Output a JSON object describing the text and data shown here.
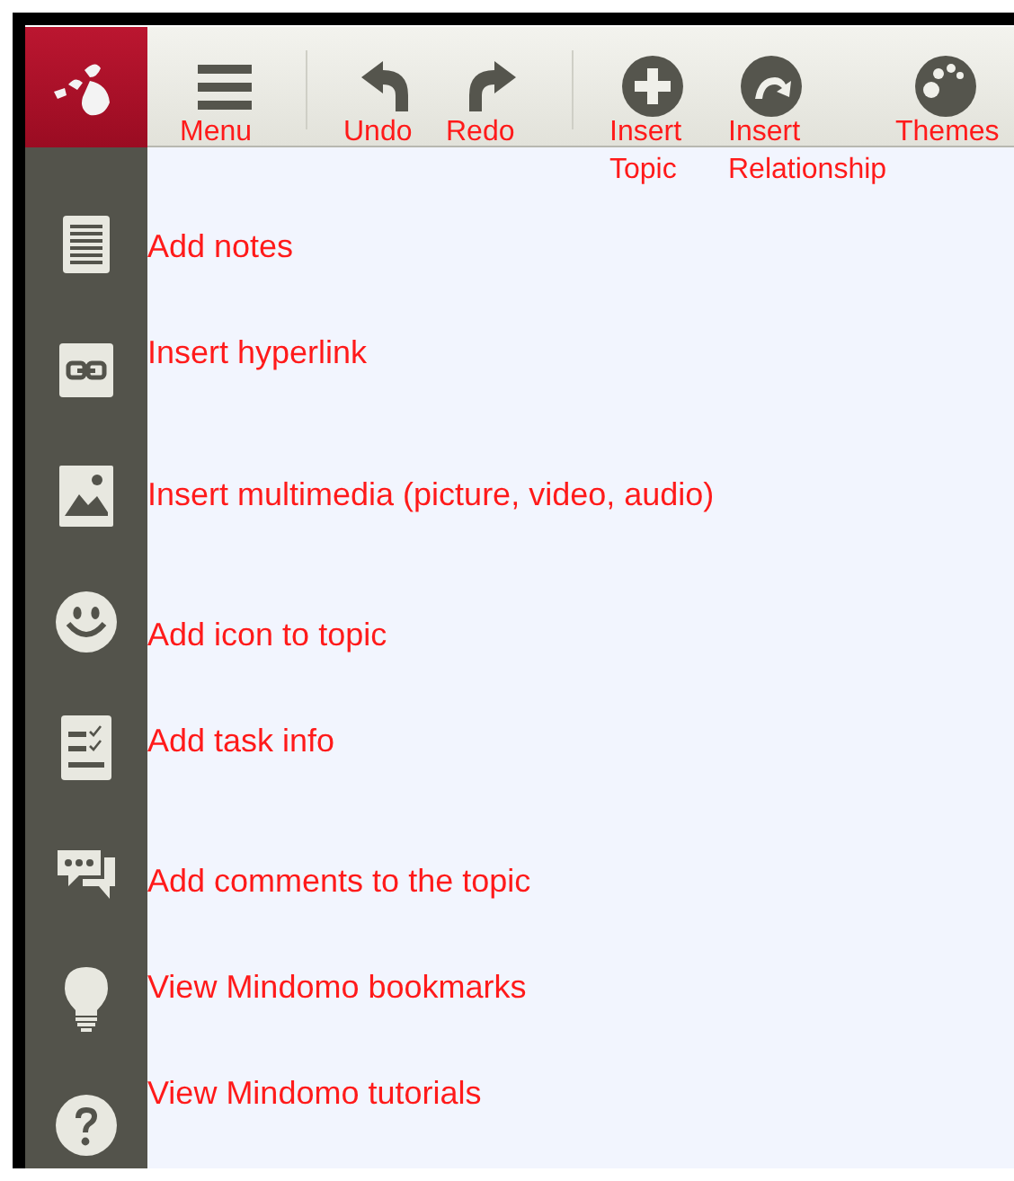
{
  "toolbar": {
    "groups": [
      {
        "buttons": [
          {
            "label": "Menu"
          }
        ]
      },
      {
        "buttons": [
          {
            "label": "Undo"
          },
          {
            "label": "Redo"
          }
        ]
      },
      {
        "buttons": [
          {
            "label": "Insert Topic"
          },
          {
            "label": "Insert Relationship"
          },
          {
            "label": "Themes"
          }
        ]
      }
    ]
  },
  "sidebar": {
    "tools": [
      {
        "annotation": "Add notes"
      },
      {
        "annotation": "Insert hyperlink"
      },
      {
        "annotation": "Insert multimedia (picture, video, audio)"
      },
      {
        "annotation": "Add icon to topic"
      },
      {
        "annotation": "Add task info"
      },
      {
        "annotation": "Add comments to the topic"
      },
      {
        "annotation": "View Mindomo bookmarks"
      },
      {
        "annotation": "View Mindomo tutorials"
      }
    ]
  }
}
